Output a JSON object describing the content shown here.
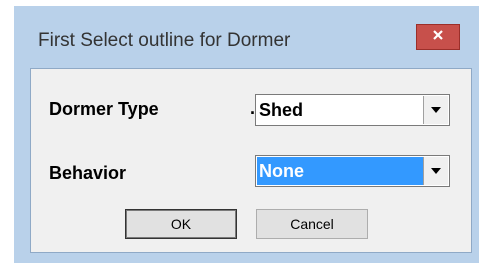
{
  "dialog": {
    "title": "First Select outline for Dormer",
    "close_icon": "close-icon"
  },
  "form": {
    "dormer_type_label": "Dormer Type",
    "dormer_type_prefix": ".",
    "dormer_type_value": "Shed",
    "behavior_label": "Behavior",
    "behavior_value": "None"
  },
  "buttons": {
    "ok_label": "OK",
    "cancel_label": "Cancel"
  },
  "colors": {
    "title_bar": "#b9d1ea",
    "close_button": "#c7504b",
    "selection": "#3399ff"
  }
}
